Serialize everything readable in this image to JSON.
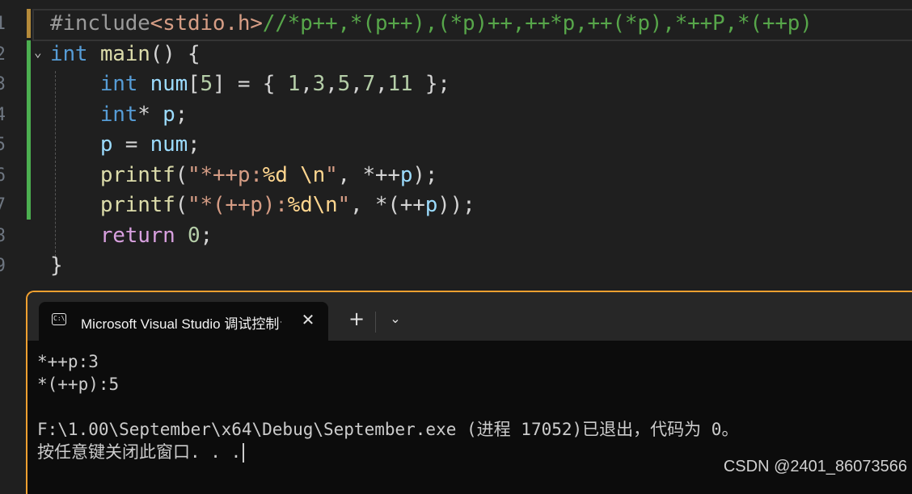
{
  "editor": {
    "line_numbers": [
      "1",
      "2",
      "3",
      "4",
      "5",
      "6",
      "7",
      "8",
      "9"
    ],
    "fold_glyph": "⌄",
    "lines": [
      [
        {
          "c": "tok-pre",
          "t": "#include"
        },
        {
          "c": "tok-inc",
          "t": "<stdio.h>"
        },
        {
          "c": "tok-cmt",
          "t": "//*p++,*(p++),(*p)++,++*p,++(*p),*++P,*(++p)"
        }
      ],
      [
        {
          "c": "tok-kw",
          "t": "int"
        },
        {
          "c": "tok-txt",
          "t": " "
        },
        {
          "c": "tok-fn",
          "t": "main"
        },
        {
          "c": "tok-pun",
          "t": "() {"
        }
      ],
      [
        {
          "c": "tok-txt",
          "t": "    "
        },
        {
          "c": "tok-kw",
          "t": "int"
        },
        {
          "c": "tok-txt",
          "t": " "
        },
        {
          "c": "tok-var",
          "t": "num"
        },
        {
          "c": "tok-pun",
          "t": "["
        },
        {
          "c": "tok-num",
          "t": "5"
        },
        {
          "c": "tok-pun",
          "t": "] = { "
        },
        {
          "c": "tok-num",
          "t": "1"
        },
        {
          "c": "tok-pun",
          "t": ","
        },
        {
          "c": "tok-num",
          "t": "3"
        },
        {
          "c": "tok-pun",
          "t": ","
        },
        {
          "c": "tok-num",
          "t": "5"
        },
        {
          "c": "tok-pun",
          "t": ","
        },
        {
          "c": "tok-num",
          "t": "7"
        },
        {
          "c": "tok-pun",
          "t": ","
        },
        {
          "c": "tok-num",
          "t": "11"
        },
        {
          "c": "tok-pun",
          "t": " };"
        }
      ],
      [
        {
          "c": "tok-txt",
          "t": "    "
        },
        {
          "c": "tok-kw",
          "t": "int"
        },
        {
          "c": "tok-pun",
          "t": "* "
        },
        {
          "c": "tok-var",
          "t": "p"
        },
        {
          "c": "tok-pun",
          "t": ";"
        }
      ],
      [
        {
          "c": "tok-txt",
          "t": "    "
        },
        {
          "c": "tok-var",
          "t": "p"
        },
        {
          "c": "tok-pun",
          "t": " = "
        },
        {
          "c": "tok-var",
          "t": "num"
        },
        {
          "c": "tok-pun",
          "t": ";"
        }
      ],
      [
        {
          "c": "tok-txt",
          "t": "    "
        },
        {
          "c": "tok-fn",
          "t": "printf"
        },
        {
          "c": "tok-pun",
          "t": "("
        },
        {
          "c": "tok-str",
          "t": "\"*++p:"
        },
        {
          "c": "tok-esc",
          "t": "%d"
        },
        {
          "c": "tok-str",
          "t": " "
        },
        {
          "c": "tok-esc",
          "t": "\\n"
        },
        {
          "c": "tok-str",
          "t": "\""
        },
        {
          "c": "tok-pun",
          "t": ", *++"
        },
        {
          "c": "tok-var",
          "t": "p"
        },
        {
          "c": "tok-pun",
          "t": ");"
        }
      ],
      [
        {
          "c": "tok-txt",
          "t": "    "
        },
        {
          "c": "tok-fn",
          "t": "printf"
        },
        {
          "c": "tok-pun",
          "t": "("
        },
        {
          "c": "tok-str",
          "t": "\"*(++p):"
        },
        {
          "c": "tok-esc",
          "t": "%d\\n"
        },
        {
          "c": "tok-str",
          "t": "\""
        },
        {
          "c": "tok-pun",
          "t": ", *(++"
        },
        {
          "c": "tok-var",
          "t": "p"
        },
        {
          "c": "tok-pun",
          "t": "));"
        }
      ],
      [
        {
          "c": "tok-txt",
          "t": "    "
        },
        {
          "c": "tok-ctl",
          "t": "return"
        },
        {
          "c": "tok-txt",
          "t": " "
        },
        {
          "c": "tok-num",
          "t": "0"
        },
        {
          "c": "tok-pun",
          "t": ";"
        }
      ],
      [
        {
          "c": "tok-pun",
          "t": "}"
        }
      ]
    ]
  },
  "terminal": {
    "tab_title": "Microsoft Visual Studio 调试控制台",
    "tab_icon_text": "C:\\",
    "close_glyph": "✕",
    "new_tab_glyph": "+",
    "dropdown_glyph": "⌄",
    "output": [
      "*++p:3",
      "*(++p):5",
      "",
      "F:\\1.00\\September\\x64\\Debug\\September.exe (进程 17052)已退出，代码为 0。",
      "按任意键关闭此窗口. . ."
    ]
  },
  "watermark": "CSDN @2401_86073566"
}
